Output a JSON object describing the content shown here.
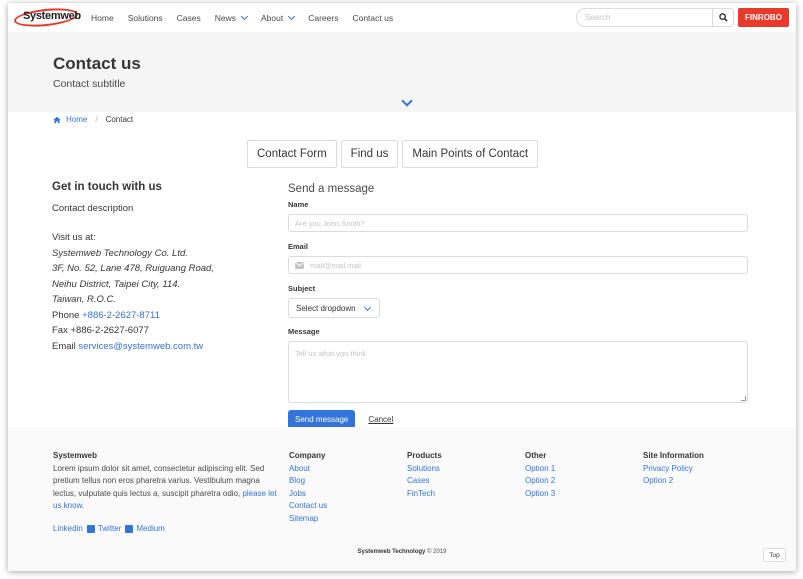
{
  "nav": {
    "logo_text": "Systemweb",
    "links": [
      {
        "label": "Home",
        "dropdown": false
      },
      {
        "label": "Solutions",
        "dropdown": false
      },
      {
        "label": "Cases",
        "dropdown": false
      },
      {
        "label": "News",
        "dropdown": true
      },
      {
        "label": "About",
        "dropdown": true
      },
      {
        "label": "Careers",
        "dropdown": false
      },
      {
        "label": "Contact us",
        "dropdown": false
      }
    ],
    "search_placeholder": "Search",
    "cta_label": "FINROBO",
    "accent": "#e8392b"
  },
  "hero": {
    "title": "Contact us",
    "subtitle": "Contact subtitle"
  },
  "breadcrumb": {
    "home": "Home",
    "separator": "/",
    "current": "Contact"
  },
  "tabs": [
    "Contact Form",
    "Find us",
    "Main Points of Contact"
  ],
  "info": {
    "heading": "Get in touch with us",
    "description": "Contact description",
    "visit_label": "Visit us at:",
    "address": [
      "Systemweb Technology Co. Ltd.",
      "3F, No. 52, Lane 478, Ruiguang Road,",
      "Neihu District, Taipei City, 114.",
      "Taiwan, R.O.C."
    ],
    "phone_label": "Phone",
    "phone": "+886-2-2627-8711",
    "fax_label": "Fax",
    "fax": "+886-2-2627-6077",
    "email_label": "Email",
    "email": "services@systemweb.com.tw"
  },
  "form": {
    "heading": "Send a message",
    "name_label": "Name",
    "name_placeholder": "Are you John Smith?",
    "email_label": "Email",
    "email_placeholder": "mail@mail.mail",
    "subject_label": "Subject",
    "subject_value": "Select dropdown",
    "message_label": "Message",
    "message_placeholder": "Tell us what you think",
    "send_label": "Send message",
    "cancel_label": "Cancel",
    "primary_color": "#3273dc"
  },
  "footer": {
    "brand": {
      "title": "Systemweb",
      "text": "Lorem ipsum dolor sit amet, consectetur adipiscing elit. Sed pretium tellus non eros pharetra varius. Vestibulum magna lectus, vulputate quis lectus a, suscipit pharetra odio,",
      "link_text": "please let us know."
    },
    "social": [
      "Linkedin",
      "Twitter",
      "Medium"
    ],
    "columns": [
      {
        "title": "Company",
        "links": [
          "About",
          "Blog",
          "Jobs",
          "Contact us",
          "Sitemap"
        ]
      },
      {
        "title": "Products",
        "links": [
          "Solutions",
          "Cases",
          "FinTech"
        ]
      },
      {
        "title": "Other",
        "links": [
          "Option 1",
          "Option 2",
          "Option 3"
        ]
      },
      {
        "title": "Site Information",
        "links": [
          "Privacy Policy",
          "Option 2"
        ]
      }
    ],
    "copyright_brand": "Systemweb Technology",
    "copyright_rest": "© 2019",
    "top_label": "Top"
  }
}
